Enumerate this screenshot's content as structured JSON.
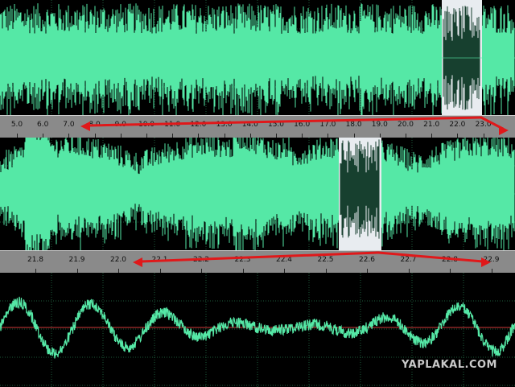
{
  "colors": {
    "waveform": "#55e8a6",
    "centerline": "#d23a3a",
    "grid": "#1c5a3a",
    "selection": "#e8ecf0",
    "selection_wave": "#17402f",
    "annotation_arrow": "#e0181a"
  },
  "ruler_top": {
    "labels": [
      "5.0",
      "6.0",
      "7.0",
      "8.0",
      "9.0",
      "10.0",
      "11.0",
      "12.0",
      "13.0",
      "14.0",
      "15.0",
      "16.0",
      "17.0",
      "18.0",
      "19.0",
      "20.0",
      "21.0",
      "22.0",
      "23.0"
    ]
  },
  "ruler_middle": {
    "labels": [
      "21.8",
      "21.9",
      "22.0",
      "22.1",
      "22.2",
      "22.3",
      "22.4",
      "22.5",
      "22.6",
      "22.7",
      "22.8",
      "22.9"
    ]
  },
  "watermark": "YAPLAKAL.COM"
}
